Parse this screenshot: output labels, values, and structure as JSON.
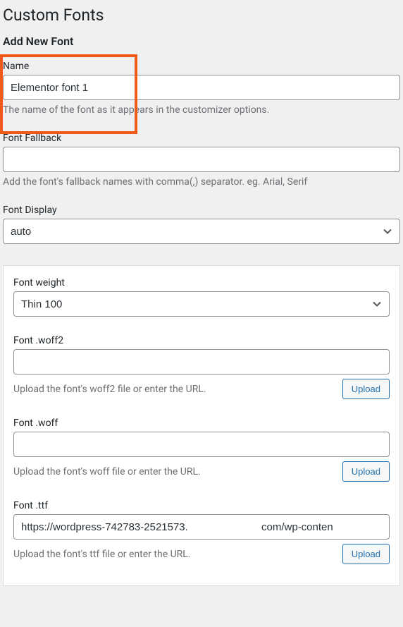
{
  "page_title": "Custom Fonts",
  "section_title": "Add New Font",
  "highlight": {
    "border_color": "#ef5a1a"
  },
  "name_field": {
    "label": "Name",
    "value": "Elementor font 1",
    "help": "The name of the font as it appears in the customizer options."
  },
  "fallback_field": {
    "label": "Font Fallback",
    "value": "",
    "help": "Add the font's fallback names with comma(,) separator. eg. Arial, Serif"
  },
  "display_field": {
    "label": "Font Display",
    "selected": "auto"
  },
  "weight_field": {
    "label": "Font weight",
    "selected": "Thin 100"
  },
  "woff2_field": {
    "label": "Font .woff2",
    "value": "",
    "help": "Upload the font's woff2 file or enter the URL.",
    "button": "Upload"
  },
  "woff_field": {
    "label": "Font .woff",
    "value": "",
    "help": "Upload the font's woff file or enter the URL.",
    "button": "Upload"
  },
  "ttf_field": {
    "label": "Font .ttf",
    "value": "https://wordpress-742783-2521573.                         com/wp-conten",
    "help": "Upload the font's ttf file or enter the URL.",
    "button": "Upload"
  }
}
